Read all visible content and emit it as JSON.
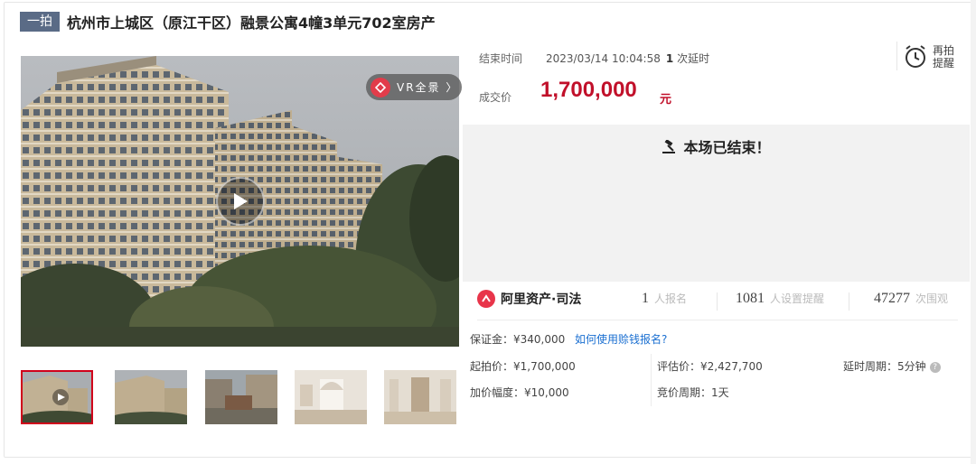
{
  "header": {
    "badge": "一拍",
    "title": "杭州市上城区（原江干区）融景公寓4幢3单元702室房产"
  },
  "media": {
    "vr_label": "VR全景 〉",
    "main_image": "apartment-building-photo",
    "thumbnails": [
      "building-video-thumb",
      "building-exterior-thumb",
      "courtyard-thumb",
      "living-room-thumb",
      "hallway-thumb"
    ]
  },
  "auction": {
    "end_time_label": "结束时间",
    "end_time": "2023/03/14 10:04:58",
    "delay_count": "1",
    "delay_text": "次延时",
    "price_label": "成交价",
    "price": "1,700,000",
    "price_unit": "元",
    "remind_line1": "再拍",
    "remind_line2": "提醒",
    "ended_text": "本场已结束！"
  },
  "stats": {
    "platform": "阿里资产·司法",
    "signups": "1",
    "signups_label": "人报名",
    "reminders": "1081",
    "reminders_label": "人设置提醒",
    "views": "47277",
    "views_label": "次围观"
  },
  "details": {
    "deposit": "保证金：¥340,000",
    "deposit_link": "如何使用赊钱报名?",
    "start_price": "起拍价：¥1,700,000",
    "appraisal": "评估价：¥2,427,700",
    "delay_period": "延时周期：5分钟",
    "increment": "加价幅度：¥10,000",
    "bid_period": "竞价周期：1天"
  },
  "colors": {
    "accent": "#c1102a",
    "badge": "#5a6b86",
    "link": "#1a6fd1"
  }
}
